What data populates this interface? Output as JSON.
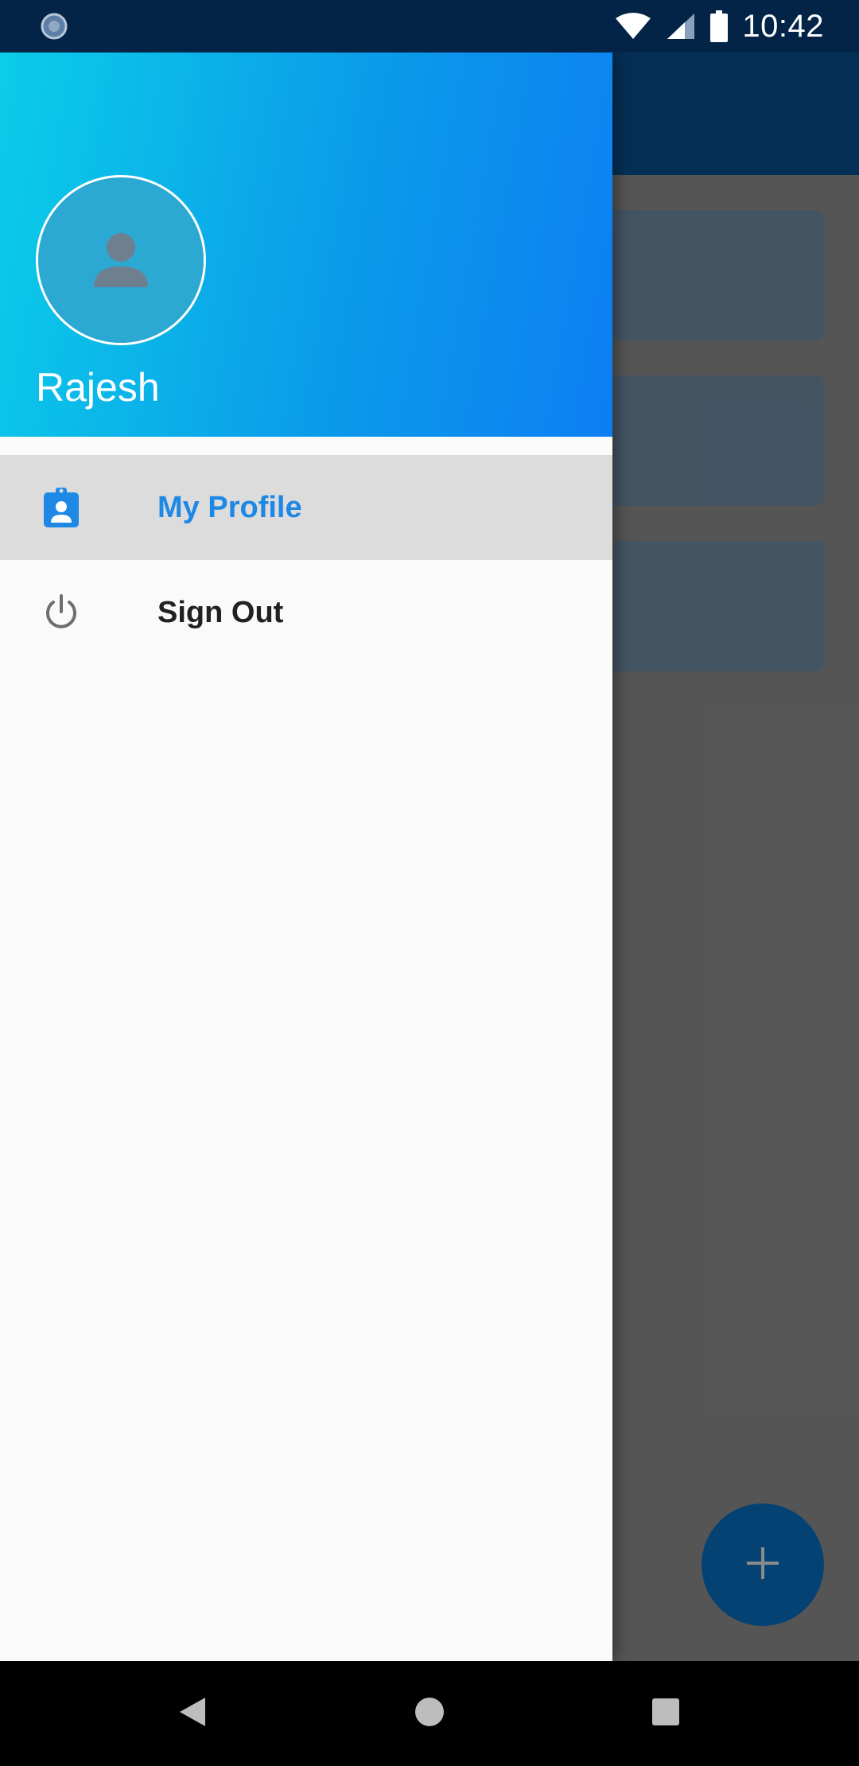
{
  "status_bar": {
    "time": "10:42",
    "icons": [
      "sync-icon",
      "wifi-icon",
      "signal-icon",
      "battery-icon"
    ]
  },
  "drawer": {
    "header": {
      "user_name": "Rajesh",
      "avatar_icon": "person-icon",
      "gradient_colors": [
        "#0bcde9",
        "#0c7ff3"
      ]
    },
    "menu_items": [
      {
        "label": "My Profile",
        "icon": "profile-badge-icon",
        "selected": true
      },
      {
        "label": "Sign Out",
        "icon": "power-icon",
        "selected": false
      }
    ],
    "accent_color": "#1e88e5"
  },
  "background_app": {
    "fab_icon": "plus-icon"
  },
  "nav_bar": {
    "buttons": [
      "back-icon",
      "home-icon",
      "recents-icon"
    ]
  }
}
